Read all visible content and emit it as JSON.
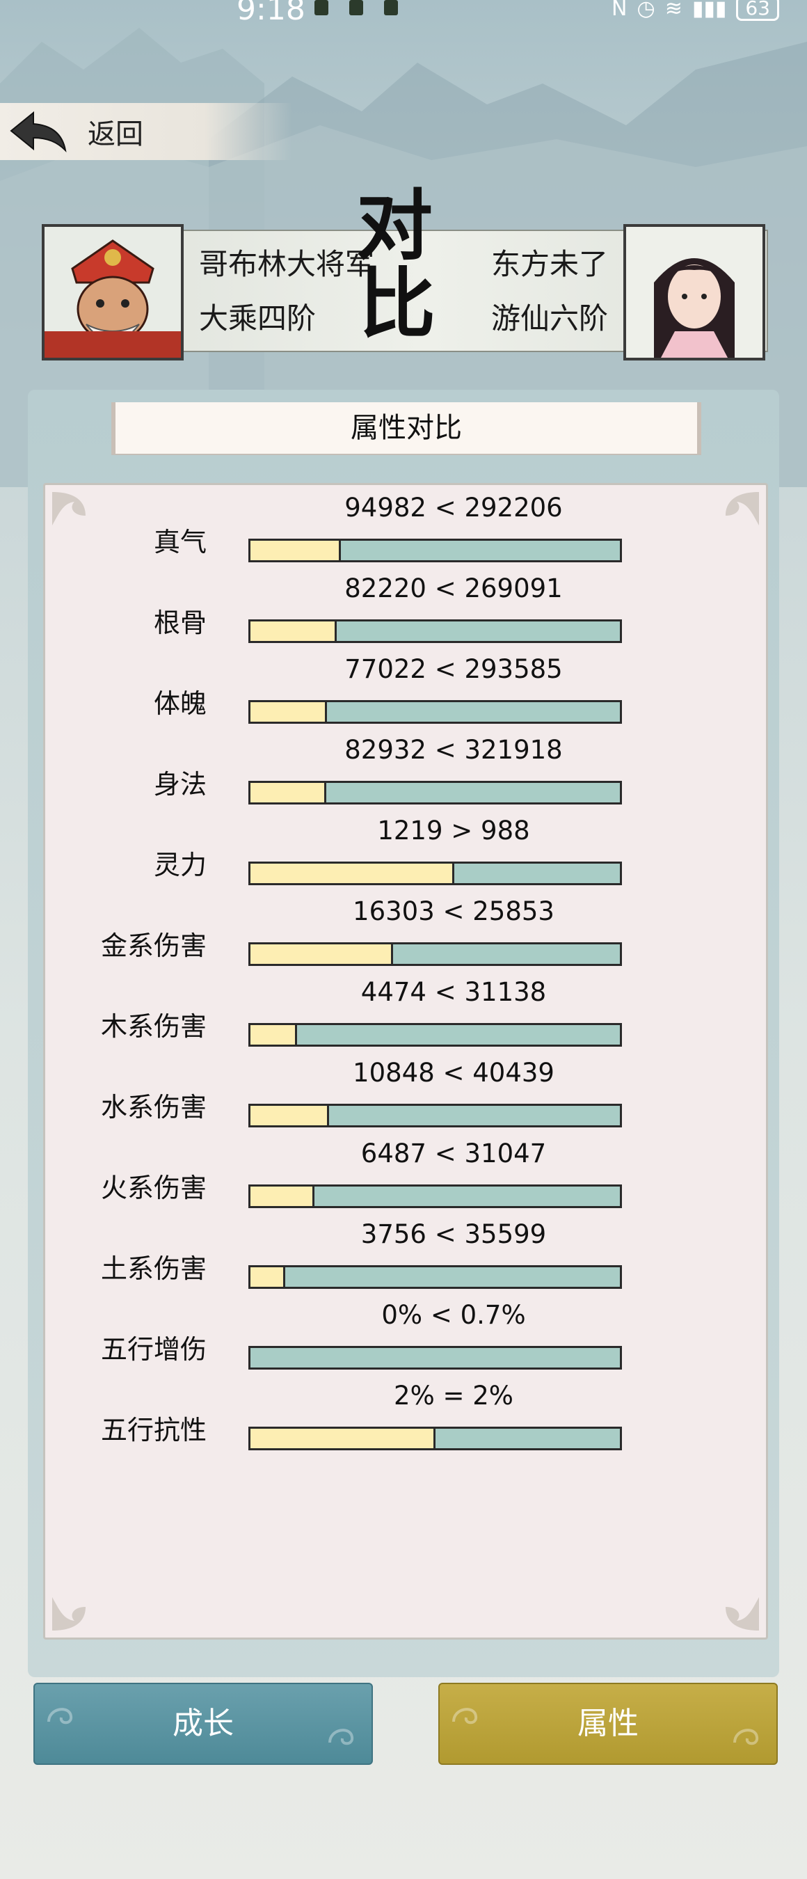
{
  "status_bar": {
    "time": "9:18",
    "battery": "63"
  },
  "nav": {
    "back_label": "返回"
  },
  "compare": {
    "left_name": "哥布林大将军",
    "left_rank": "大乘四阶",
    "right_name": "东方未了",
    "right_rank": "游仙六阶",
    "center_char_1": "对",
    "center_char_2": "比"
  },
  "section_title": "属性对比",
  "stats": [
    {
      "label": "真气",
      "value_text": "94982 < 292206",
      "left_share": 0.245
    },
    {
      "label": "根骨",
      "value_text": "82220 < 269091",
      "left_share": 0.234
    },
    {
      "label": "体魄",
      "value_text": "77022 < 293585",
      "left_share": 0.208
    },
    {
      "label": "身法",
      "value_text": "82932 < 321918",
      "left_share": 0.205
    },
    {
      "label": "灵力",
      "value_text": "1219 > 988",
      "left_share": 0.552
    },
    {
      "label": "金系伤害",
      "value_text": "16303 < 25853",
      "left_share": 0.387
    },
    {
      "label": "木系伤害",
      "value_text": "4474 < 31138",
      "left_share": 0.126
    },
    {
      "label": "水系伤害",
      "value_text": "10848 < 40439",
      "left_share": 0.212
    },
    {
      "label": "火系伤害",
      "value_text": "6487 < 31047",
      "left_share": 0.173
    },
    {
      "label": "土系伤害",
      "value_text": "3756 < 35599",
      "left_share": 0.095
    },
    {
      "label": "五行增伤",
      "value_text": "0% < 0.7%",
      "left_share": 0.0
    },
    {
      "label": "五行抗性",
      "value_text": "2% = 2%",
      "left_share": 0.5
    }
  ],
  "buttons": {
    "growth": "成长",
    "attributes": "属性"
  },
  "colors": {
    "left_fill": "#fdeeb3",
    "right_fill": "#a9cdc6",
    "growth_button": "#5b95a2",
    "attributes_button": "#bca33c"
  }
}
